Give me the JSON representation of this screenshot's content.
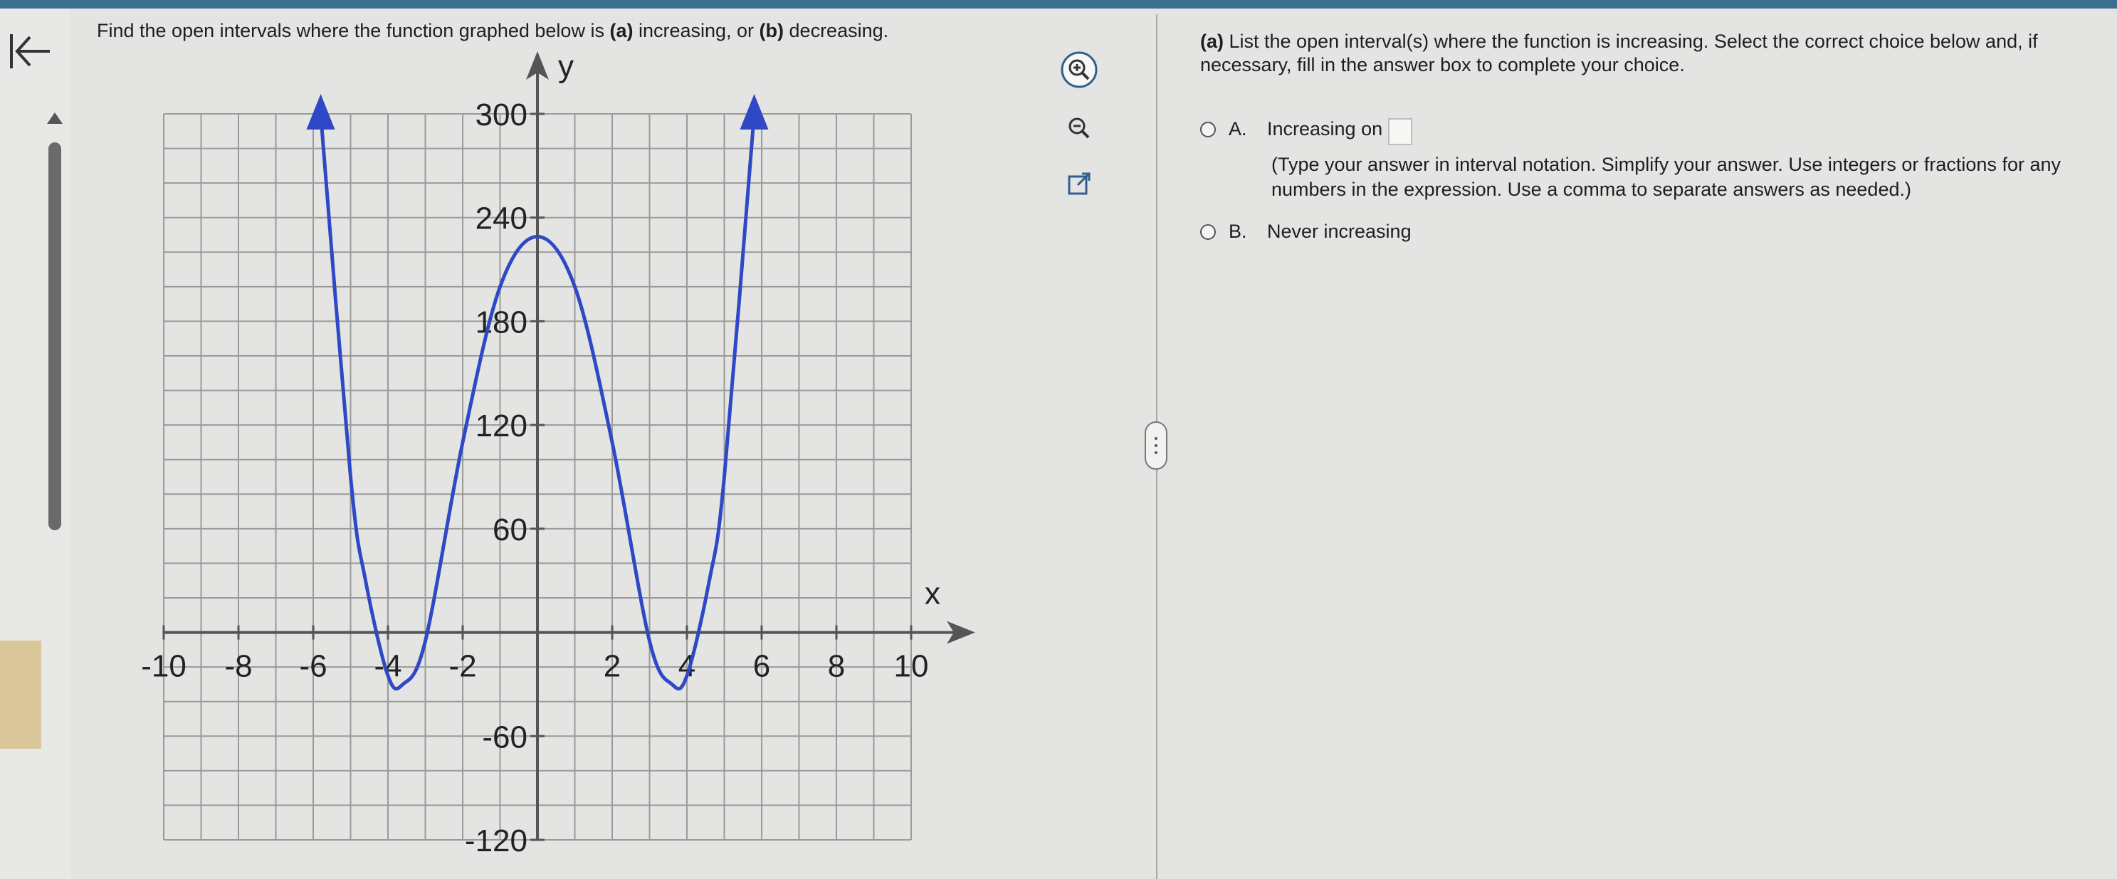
{
  "question": {
    "text_before": "Find the open intervals where the function graphed below is ",
    "part_a": "(a)",
    "text_mid1": " increasing, or ",
    "part_b": "(b)",
    "text_mid2": " decreasing."
  },
  "graph": {
    "y_label": "y",
    "x_label": "x",
    "x_ticks": [
      "-10",
      "-8",
      "-6",
      "-4",
      "-2",
      "2",
      "4",
      "6",
      "8",
      "10"
    ],
    "y_ticks": [
      "300",
      "240",
      "180",
      "120",
      "60",
      "-60",
      "-120"
    ],
    "curve_color": "#2f49c6"
  },
  "chart_data": {
    "type": "line",
    "xlim": [
      -10,
      10
    ],
    "ylim": [
      -120,
      300
    ],
    "grid": true,
    "x_ticks": [
      -10,
      -8,
      -6,
      -4,
      -2,
      2,
      4,
      6,
      8,
      10
    ],
    "y_ticks": [
      300,
      240,
      180,
      120,
      60,
      -60,
      -120
    ],
    "series": [
      {
        "points": [
          [
            -5.8,
            300
          ],
          [
            -5,
            90
          ],
          [
            -4.6,
            30
          ],
          [
            -4,
            -25
          ],
          [
            -3.6,
            -30
          ],
          [
            -3,
            -5
          ],
          [
            -2,
            110
          ],
          [
            -1,
            200
          ],
          [
            0,
            229
          ],
          [
            1,
            200
          ],
          [
            2,
            110
          ],
          [
            3,
            -5
          ],
          [
            3.6,
            -30
          ],
          [
            4,
            -25
          ],
          [
            4.6,
            30
          ],
          [
            5,
            90
          ],
          [
            5.8,
            300
          ]
        ],
        "arrows": "both-ends-up"
      }
    ]
  },
  "tools": {
    "zoom_in": "zoom-in",
    "zoom_out": "zoom-out",
    "popout": "open-in-new-window"
  },
  "panel": {
    "part": "(a)",
    "instruction": " List the open interval(s) where the function is increasing. Select the correct choice below and, if necessary, fill in the answer box to complete your choice.",
    "choices": [
      {
        "letter": "A.",
        "label": "Increasing on",
        "hint": "(Type your answer in interval notation. Simplify your answer. Use integers or fractions for any numbers in the expression. Use a comma to separate answers as needed.)"
      },
      {
        "letter": "B.",
        "label": "Never increasing"
      }
    ]
  }
}
